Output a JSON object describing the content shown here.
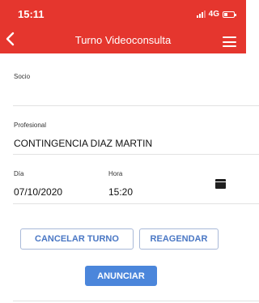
{
  "status_bar": {
    "time": "15:11",
    "network": "4G"
  },
  "header": {
    "title": "Turno Videoconsulta"
  },
  "form": {
    "socio": {
      "label": "Socio",
      "value": ""
    },
    "profesional": {
      "label": "Profesional",
      "value": "CONTINGENCIA DIAZ MARTIN"
    },
    "dia": {
      "label": "Día",
      "value": "07/10/2020"
    },
    "hora": {
      "label": "Hora",
      "value": "15:20"
    }
  },
  "actions": {
    "cancel_label": "CANCELAR TURNO",
    "reschedule_label": "REAGENDAR",
    "announce_label": "ANUNCIAR"
  },
  "colors": {
    "header": "#e5362e",
    "accent": "#4b86db"
  },
  "icons": [
    "back-icon",
    "menu-icon",
    "signal-icon",
    "battery-icon",
    "calendar-icon"
  ]
}
